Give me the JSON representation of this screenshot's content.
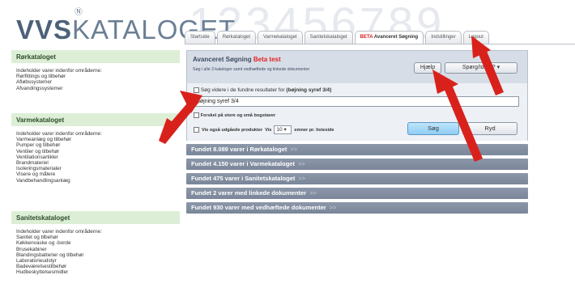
{
  "header": {
    "logo_bold": "VVS",
    "logo_light": "KATALOGET",
    "logo_mark": "Ⓝ",
    "background_digits": "123456789"
  },
  "tabs": [
    {
      "label": "Startside",
      "active": false
    },
    {
      "label": "Rørkataloget",
      "active": false
    },
    {
      "label": "Varmekataloget",
      "active": false
    },
    {
      "label": "Sanitetskataloget",
      "active": false
    },
    {
      "label_beta": "BETA",
      "label": " Avanceret Søgning",
      "active": true
    },
    {
      "label": "Indstillinger",
      "active": false
    },
    {
      "label": "Logout",
      "active": false
    }
  ],
  "sidebar": {
    "sections": [
      {
        "title": "Rørkataloget",
        "intro": "Indeholder varer indenfor områderne:",
        "items": [
          "Rørfittings og tilbehør",
          "Afløbssystemer",
          "Afvandingssystemer"
        ]
      },
      {
        "title": "Varmekataloget",
        "intro": "Indeholder varer indenfor områderne:",
        "items": [
          "Varmeanlæg og tilbehør",
          "Pumper og tilbehør",
          "Ventiler og tilbehør",
          "Ventilationsartikler",
          "Brandmateriel",
          "Isoleringsmaterialer",
          "Visere og målere",
          "Vandbehandlingsanlæg"
        ]
      },
      {
        "title": "Sanitetskataloget",
        "intro": "Indeholder varer indenfor områderne:",
        "items": [
          "Sanitet og tilbehør",
          "Køkkenvaske og -borde",
          "Brusekabiner",
          "Blandingsbatterier og tilbehør",
          "Laboratorieudstyr",
          "Badeværelsestilbehør",
          "Hudbeskyttelsesmidler"
        ]
      }
    ]
  },
  "search_panel": {
    "title": "Avanceret Søgning",
    "title_beta": "Beta test",
    "subtitle": "Søg i alle 3 kataloger samt vedhæftede og linkede dokumenter",
    "help_label": "Hjælp",
    "faq_label": "Spørg/Ideer? ▾",
    "search_within_label": "Søg videre i de fundne resultater for",
    "search_within_term": "(bøjning syref 3/4)",
    "query_value": "bøjning syref 3/4",
    "case_label": "Forskel på store og små bogstaver",
    "expired_label": "Vis også udgåede produkter",
    "show_label": "Vis",
    "per_page_value": "10",
    "per_page_suffix": "emner pr. listeside",
    "search_button": "Søg",
    "reset_button": "Ryd"
  },
  "results": [
    {
      "label": "Fundet 8.089 varer i Rørkataloget",
      "arrow": ">>"
    },
    {
      "label": "Fundet 4.150 varer i Varmekataloget",
      "arrow": ">>"
    },
    {
      "label": "Fundet 475 varer i Sanitetskataloget",
      "arrow": ">>"
    },
    {
      "label": "Fundet 2 varer med linkede dokumenter",
      "arrow": ">>"
    },
    {
      "label": "Fundet 930 varer med vedhæftede dokumenter",
      "arrow": ">>"
    }
  ],
  "colors": {
    "accent_red": "#e02222",
    "section_green": "#dcefd6",
    "result_bar": "#7a8699",
    "search_blue": "#8fcdf4",
    "arrow_red": "#d9211c"
  }
}
